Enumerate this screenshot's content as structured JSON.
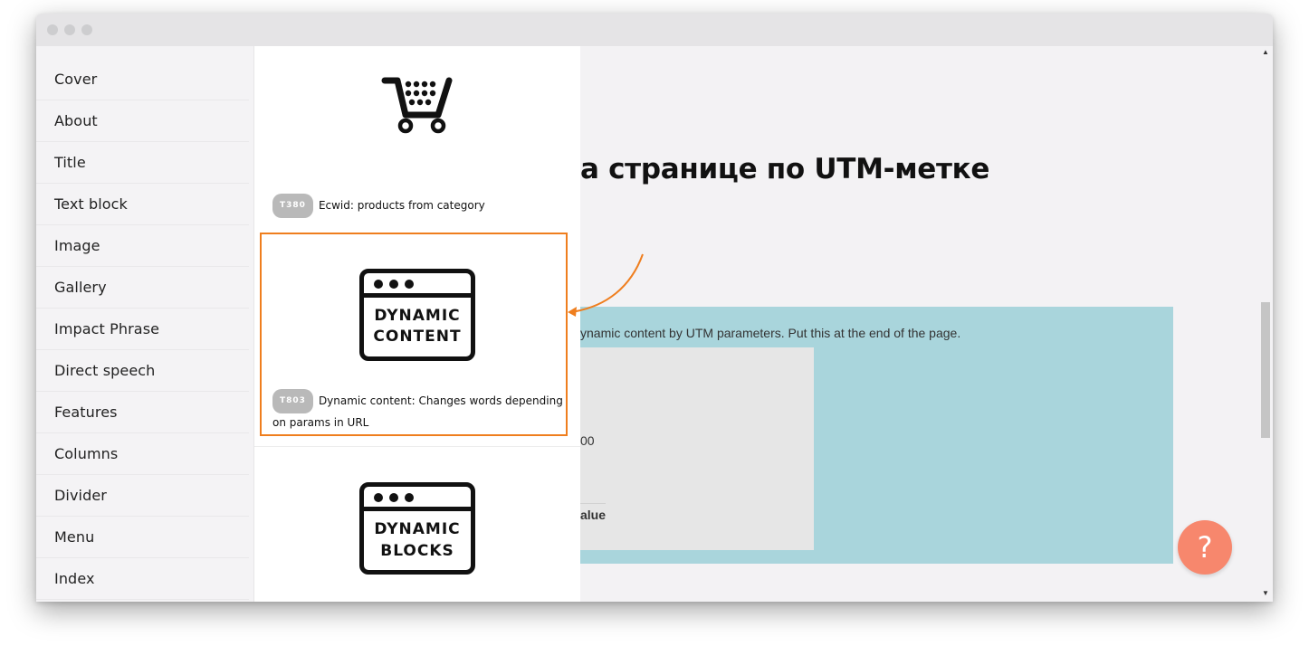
{
  "sidebar": {
    "items": [
      {
        "label": "Cover"
      },
      {
        "label": "About"
      },
      {
        "label": "Title"
      },
      {
        "label": "Text block"
      },
      {
        "label": "Image"
      },
      {
        "label": "Gallery"
      },
      {
        "label": "Impact Phrase"
      },
      {
        "label": "Direct speech"
      },
      {
        "label": "Features"
      },
      {
        "label": "Columns"
      },
      {
        "label": "Divider"
      },
      {
        "label": "Menu"
      },
      {
        "label": "Index"
      }
    ]
  },
  "blocks": [
    {
      "code": "T380",
      "title": "Ecwid: products from category",
      "icon": "shopping-cart-icon"
    },
    {
      "code": "T803",
      "title": "Dynamic content: Changes words depending on params in URL",
      "icon": "dynamic-content-icon",
      "icon_text": [
        "DYNAMIC",
        "CONTENT"
      ],
      "selected": true
    },
    {
      "icon": "dynamic-blocks-icon",
      "icon_text": [
        "DYNAMIC",
        "BLOCKS"
      ]
    }
  ],
  "preview": {
    "heading": "а странице по UTM-метке",
    "description": "ynamic content by UTM parameters. Put this at the end of the page.",
    "number_fragment": "00",
    "value_fragment": "alue"
  },
  "help_button": {
    "label": "?"
  },
  "colors": {
    "highlight": "#ef7e1e",
    "teal_block": "#a9d5dc",
    "help_button": "#f7876d"
  }
}
